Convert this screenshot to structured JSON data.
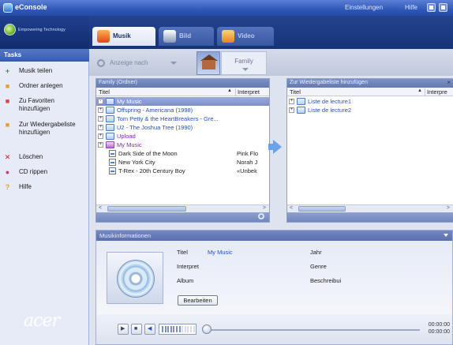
{
  "app": {
    "title": "eConsole",
    "settings_label": "Einstellungen",
    "help_label": "Hilfe",
    "slogan": "Empowering Technology",
    "brand": "acer"
  },
  "sidebar": {
    "heading": "Tasks",
    "items": [
      {
        "label": "Musik teilen",
        "icon": "plus-icon",
        "color": "#2e9a2e"
      },
      {
        "label": "Ordner anlegen",
        "icon": "folder-icon",
        "color": "#e8a020"
      },
      {
        "label": "Zu Favoriten hinzufügen",
        "icon": "favorites-icon",
        "color": "#e04040"
      },
      {
        "label": "Zur Wiedergabeliste hinzufügen",
        "icon": "playlist-icon",
        "color": "#e8a020"
      },
      {
        "label": "Löschen",
        "icon": "delete-icon",
        "color": "#d02020"
      },
      {
        "label": "CD rippen",
        "icon": "cd-icon",
        "color": "#c04070"
      },
      {
        "label": "Hilfe",
        "icon": "help-icon",
        "color": "#e8a020"
      }
    ]
  },
  "tabs": [
    {
      "label": "Musik",
      "active": true
    },
    {
      "label": "Bild",
      "active": false
    },
    {
      "label": "Video",
      "active": false
    }
  ],
  "toolbar": {
    "view_label": "Anzeige nach",
    "family_label": "Family"
  },
  "left_pane": {
    "header": "Family (Ordner)",
    "col_title": "Titel",
    "col_artist": "Interpret",
    "rows": [
      {
        "label": "My Music",
        "artist": "",
        "type": "folder",
        "expand": "-",
        "selected": true,
        "indent": 0,
        "style": "plain"
      },
      {
        "label": "Offspring - Americana (1998)",
        "artist": "",
        "type": "folder",
        "expand": "+",
        "selected": false,
        "indent": 0,
        "style": "blue"
      },
      {
        "label": "Tom Petty & the HeartBreakers - Gre...",
        "artist": "",
        "type": "folder",
        "expand": "+",
        "selected": false,
        "indent": 0,
        "style": "blue"
      },
      {
        "label": "U2 - The Joshua Tree (1990)",
        "artist": "",
        "type": "folder",
        "expand": "+",
        "selected": false,
        "indent": 0,
        "style": "blue"
      },
      {
        "label": "Upload",
        "artist": "",
        "type": "folder",
        "expand": "+",
        "selected": false,
        "indent": 0,
        "style": "purple"
      },
      {
        "label": "My Music",
        "artist": "",
        "type": "music",
        "expand": "+",
        "selected": false,
        "indent": 0,
        "style": "purple"
      },
      {
        "label": "Dark Side of the Moon",
        "artist": "Pink Flo",
        "type": "doc",
        "expand": "",
        "selected": false,
        "indent": 1,
        "style": "plain"
      },
      {
        "label": "New York City",
        "artist": "Norah J",
        "type": "doc",
        "expand": "",
        "selected": false,
        "indent": 1,
        "style": "plain"
      },
      {
        "label": "T-Rex - 20th Century Boy",
        "artist": "«Unbek",
        "type": "doc",
        "expand": "",
        "selected": false,
        "indent": 1,
        "style": "plain"
      }
    ]
  },
  "right_pane": {
    "header": "Zur Wiedergabeliste hinzufügen",
    "close_label": "×",
    "col_title": "Titel",
    "col_artist": "Interpre",
    "rows": [
      {
        "label": "Liste de lecture1"
      },
      {
        "label": "Liste de lecture2"
      }
    ]
  },
  "info": {
    "header": "Musikinformationen",
    "title_label": "Titel",
    "title_value": "My Music",
    "artist_label": "Interpret",
    "album_label": "Album",
    "year_label": "Jahr",
    "genre_label": "Genre",
    "desc_label": "Beschreibui",
    "edit_label": "Bearbeiten"
  },
  "player": {
    "time_elapsed": "00:00:00",
    "time_total": "00:00:00",
    "volume_level": 0.6,
    "position": 0
  }
}
